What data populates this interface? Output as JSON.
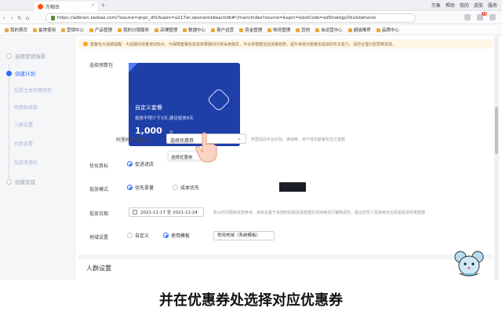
{
  "browser": {
    "tab_title": "万相台",
    "window_controls": [
      "万象",
      "帮助",
      "我的",
      "皮肤",
      "服务"
    ],
    "url": "https://adbrain.taobao.com/?source=qnpc_dhl/&spm=a217wi.openworkbeachdb#!/main/index?source=&spm=&bizCode=adStrategyDkx&behavio",
    "bookmarks": [
      "我的首页",
      "最常使用",
      "营销中心",
      "产品管理",
      "我的分销服务",
      "店铺管理",
      "数据中心",
      "客户运营",
      "资金管理",
      "物流管理",
      "其他",
      "自运营中心",
      "超级推荐",
      "品牌中心"
    ],
    "badge_count": "78"
  },
  "sidebar": {
    "steps": [
      {
        "label": "选择营销场景",
        "active": false
      },
      {
        "label": "创建计划",
        "active": true
      },
      {
        "label": "创建完成",
        "active": false
      }
    ],
    "substeps": [
      "投放主体和落地页",
      "预算和排期",
      "人群设置",
      "创意设置",
      "投放资源位"
    ]
  },
  "main": {
    "notice": "套餐包大促期提醒：大促期间流量波动较大，为保障套餐包投放效果期间内将采用最优，平台将根据活动流量趋势，提升系统对套餐包投放的优化能力，请您合理分配预算投放。",
    "budget_label": "选择预算包",
    "card": {
      "title": "自定义套餐",
      "desc": "投放不得少于3天,建议投放8天",
      "amount": "1,000",
      "unit": "元"
    },
    "coupon_label": "阿里妈妈优惠券",
    "coupon_select": "选择优惠券",
    "coupon_hint": "阿里妈妈平台红包、满减券、用于抵扣套餐包支付金额",
    "coupon_option": "选择优惠券",
    "goal_label": "优化目标",
    "goal_option": "促进进店",
    "mode_label": "投放模式",
    "mode_options": [
      "优先拿量",
      "成本优先"
    ],
    "date_label": "投放日期",
    "date_range": "2021-11-17  至  2021-11-24",
    "date_hint": "默认时间限制投放参考。系统会基于投放时段和投放数据实现持续进行策略调优，建议您至少投放两天后再看投放效果数据",
    "region_label": "地域设置",
    "region_options": [
      "自定义",
      "使用模板"
    ],
    "region_template": "常用地域（系统模板）",
    "section_title": "人群设置"
  },
  "caption": "并在优惠券处选择对应优惠券"
}
